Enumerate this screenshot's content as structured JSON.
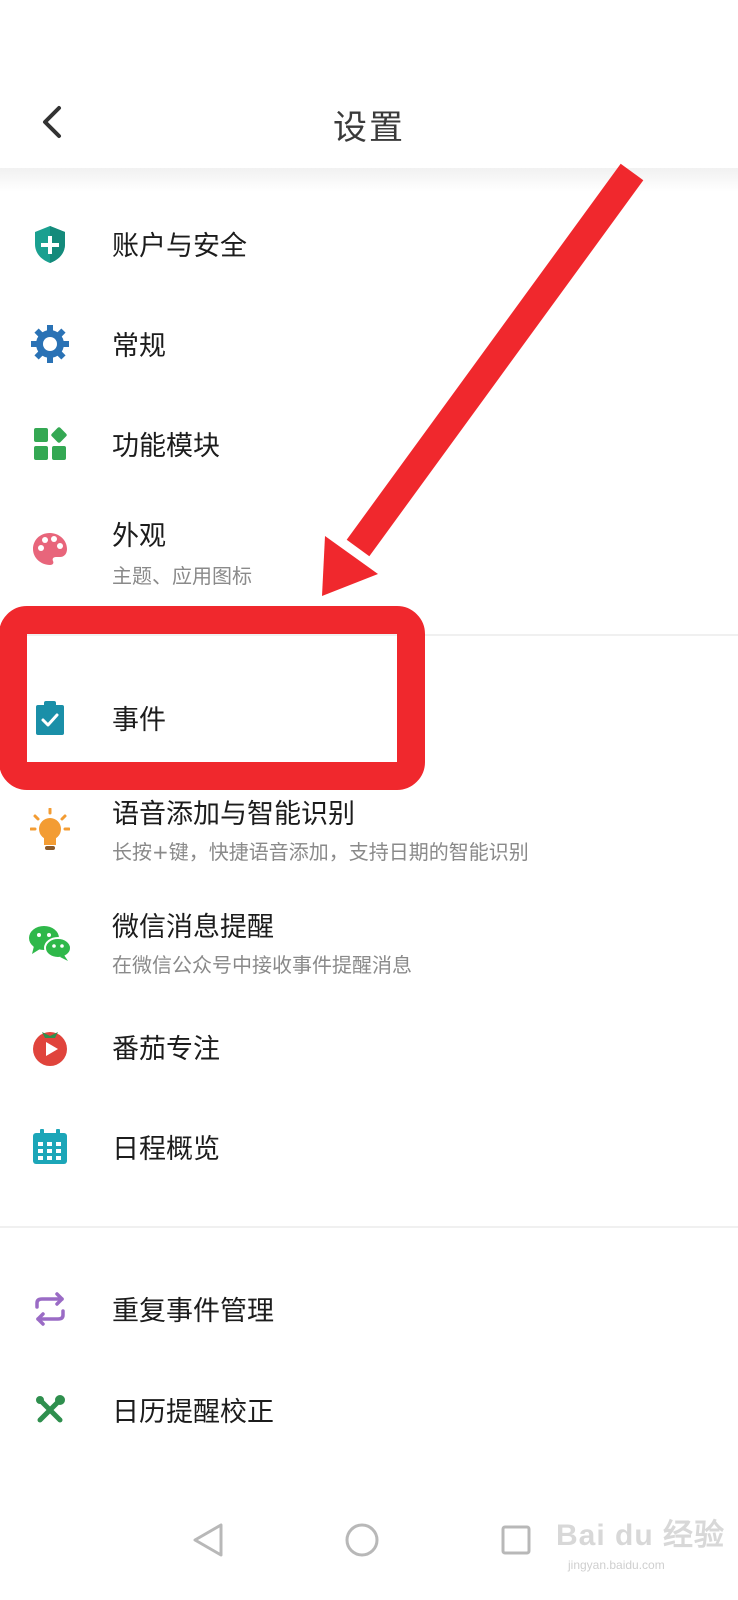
{
  "header": {
    "title": "设置"
  },
  "items": [
    {
      "label": "账户与安全",
      "icon": "shield-icon",
      "color": "#1aa090"
    },
    {
      "label": "常规",
      "icon": "gear-icon",
      "color": "#2a72b5"
    },
    {
      "label": "功能模块",
      "icon": "modules-icon",
      "color": "#34a853"
    },
    {
      "label": "外观",
      "sub": "主题、应用图标",
      "icon": "palette-icon",
      "color": "#e8657b"
    },
    {
      "label": "事件",
      "icon": "clipboard-check-icon",
      "color": "#1a8fa8"
    },
    {
      "label": "语音添加与智能识别",
      "sub": "长按+键，快捷语音添加，支持日期的智能识别",
      "icon": "lightbulb-icon",
      "color": "#f39c33"
    },
    {
      "label": "微信消息提醒",
      "sub": "在微信公众号中接收事件提醒消息",
      "icon": "wechat-icon",
      "color": "#2fb84a"
    },
    {
      "label": "番茄专注",
      "icon": "tomato-icon",
      "color": "#e0443c"
    },
    {
      "label": "日程概览",
      "icon": "calendar-grid-icon",
      "color": "#1ca6b8"
    },
    {
      "label": "重复事件管理",
      "icon": "repeat-icon",
      "color": "#9a6bc5"
    },
    {
      "label": "日历提醒校正",
      "icon": "tools-icon",
      "color": "#2f8f4e"
    }
  ],
  "watermark": {
    "text": "Bai du 经验",
    "sub": "jingyan.baidu.com"
  },
  "annotation": {
    "color": "#f0282d"
  }
}
